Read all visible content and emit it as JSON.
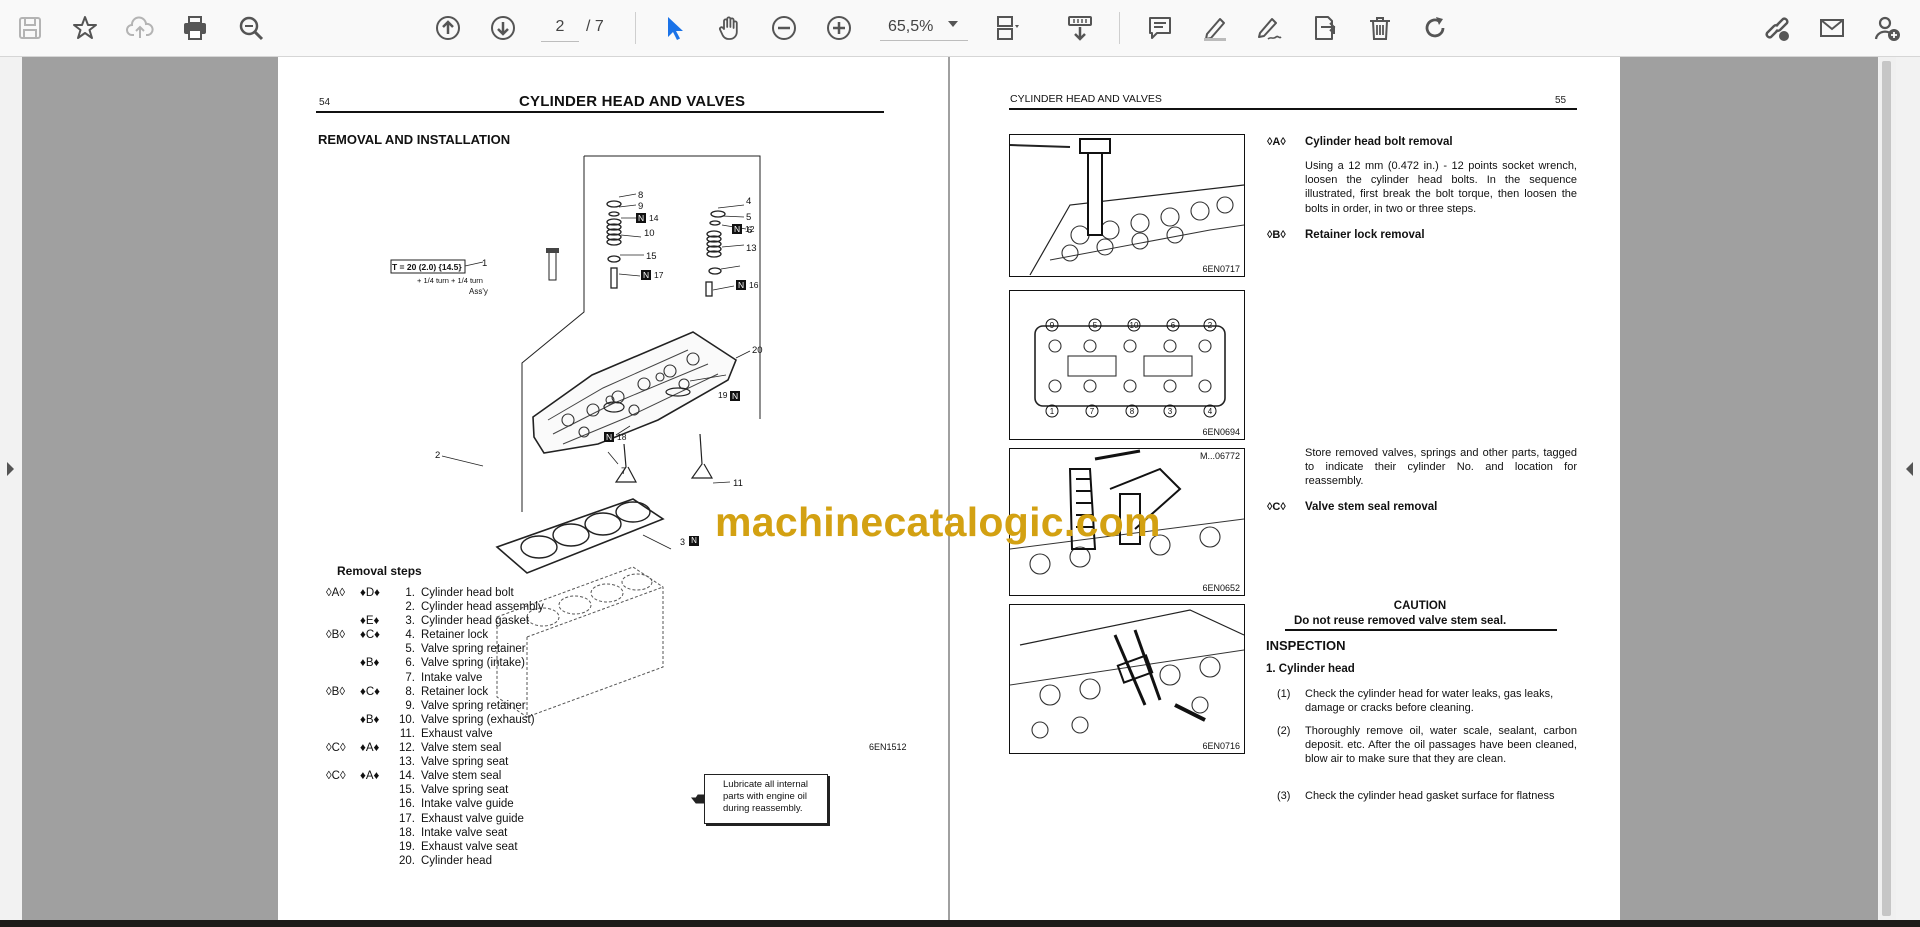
{
  "toolbar": {
    "left_icons": [
      "save-icon",
      "bookmark-star-icon",
      "cloud-upload-icon",
      "print-icon",
      "zoom-search-icon"
    ],
    "nav_icons": [
      "page-up-icon",
      "page-down-icon"
    ],
    "page_current": "2",
    "page_total": "/ 7",
    "tool_icons": [
      "select-cursor-icon",
      "hand-pan-icon",
      "zoom-out-icon",
      "zoom-in-icon"
    ],
    "zoom_value": "65,5%",
    "view_icons": [
      "page-layout-icon",
      "scroll-mode-icon"
    ],
    "comment_icons": [
      "comment-icon",
      "highlight-pen-icon",
      "sign-pen-icon",
      "stamp-icon",
      "delete-icon",
      "redo-icon"
    ],
    "right_icons": [
      "share-link-icon",
      "email-icon",
      "add-user-icon"
    ]
  },
  "left_page": {
    "page_number": "54",
    "title": "CYLINDER HEAD AND VALVES",
    "section": "REMOVAL AND INSTALLATION",
    "torque_label": "T = 20 (2.0) {14.5}",
    "torque_sub": "+ 1/4 turn + 1/4 turn",
    "torque_assy": "Ass'y",
    "figure_code": "6EN1512",
    "removal_steps_title": "Removal steps",
    "removal_steps": [
      {
        "ref": "◊A◊",
        "inst": "♦D♦",
        "num": "1.",
        "text": "Cylinder head bolt"
      },
      {
        "ref": "",
        "inst": "",
        "num": "2.",
        "text": "Cylinder head assembly"
      },
      {
        "ref": "",
        "inst": "♦E♦",
        "num": "3.",
        "text": "Cylinder head gasket"
      },
      {
        "ref": "◊B◊",
        "inst": "♦C♦",
        "num": "4.",
        "text": "Retainer lock"
      },
      {
        "ref": "",
        "inst": "",
        "num": "5.",
        "text": "Valve spring retainer"
      },
      {
        "ref": "",
        "inst": "♦B♦",
        "num": "6.",
        "text": "Valve spring (intake)"
      },
      {
        "ref": "",
        "inst": "",
        "num": "7.",
        "text": "Intake valve"
      },
      {
        "ref": "◊B◊",
        "inst": "♦C♦",
        "num": "8.",
        "text": "Retainer lock"
      },
      {
        "ref": "",
        "inst": "",
        "num": "9.",
        "text": "Valve spring retainer"
      },
      {
        "ref": "",
        "inst": "♦B♦",
        "num": "10.",
        "text": "Valve spring (exhaust)"
      },
      {
        "ref": "",
        "inst": "",
        "num": "11.",
        "text": "Exhaust valve"
      },
      {
        "ref": "◊C◊",
        "inst": "♦A♦",
        "num": "12.",
        "text": "Valve stem seal"
      },
      {
        "ref": "",
        "inst": "",
        "num": "13.",
        "text": "Valve spring seat"
      },
      {
        "ref": "◊C◊",
        "inst": "♦A♦",
        "num": "14.",
        "text": "Valve stem seal"
      },
      {
        "ref": "",
        "inst": "",
        "num": "15.",
        "text": "Valve spring seat"
      },
      {
        "ref": "",
        "inst": "",
        "num": "16.",
        "text": "Intake valve guide"
      },
      {
        "ref": "",
        "inst": "",
        "num": "17.",
        "text": "Exhaust valve guide"
      },
      {
        "ref": "",
        "inst": "",
        "num": "18.",
        "text": "Intake valve seat"
      },
      {
        "ref": "",
        "inst": "",
        "num": "19.",
        "text": "Exhaust valve seat"
      },
      {
        "ref": "",
        "inst": "",
        "num": "20.",
        "text": "Cylinder head"
      }
    ],
    "note_lines": [
      "Lubricate all internal",
      "parts with engine oil",
      "during reassembly."
    ]
  },
  "right_page": {
    "page_number": "55",
    "title": "CYLINDER HEAD AND VALVES",
    "figures": [
      "6EN0717",
      "6EN0694",
      "6EN0652",
      "6EN0716"
    ],
    "fig3_top_code": "M...06772",
    "steps": [
      {
        "ref": "◊A◊",
        "title": "Cylinder head bolt removal",
        "text": "Using a 12 mm (0.472 in.) - 12 points socket wrench, loosen the cylinder head bolts. In the sequence illustrated, first break the bolt torque, then loosen the bolts in order, in two or three steps."
      },
      {
        "ref": "◊B◊",
        "title": "Retainer lock removal",
        "text": ""
      },
      {
        "ref": "",
        "title": "",
        "text": "Store removed valves, springs and other parts, tagged to indicate their cylinder No. and location for reassembly."
      },
      {
        "ref": "◊C◊",
        "title": "Valve stem seal removal",
        "text": ""
      }
    ],
    "caution_title": "CAUTION",
    "caution_text": "Do not reuse removed valve stem seal.",
    "inspection_title": "INSPECTION",
    "inspection_item": "1.  Cylinder head",
    "inspection_points": [
      {
        "num": "(1)",
        "text": "Check the cylinder head for water leaks, gas leaks, damage or cracks before cleaning."
      },
      {
        "num": "(2)",
        "text": "Thoroughly remove oil, water scale, sealant, carbon deposit. etc. After the oil passages have been cleaned, blow air to make sure that they are clean."
      },
      {
        "num": "(3)",
        "text": "Check the cylinder head gasket surface for flatness"
      }
    ]
  },
  "watermark": "machinecatalogic.com"
}
